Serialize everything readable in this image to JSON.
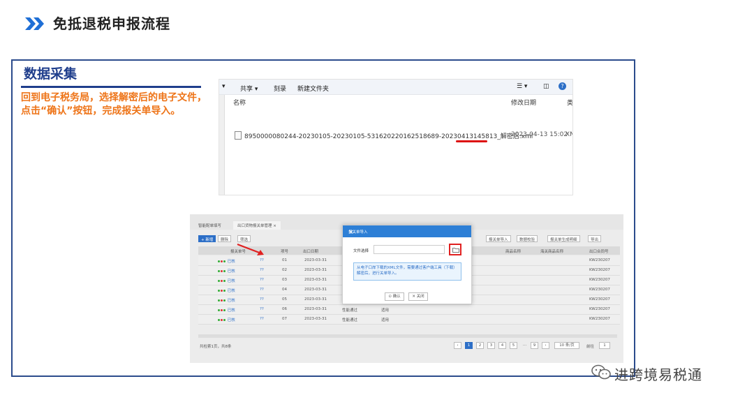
{
  "header": {
    "title": "免抵退税申报流程"
  },
  "section": {
    "title": "数据采集",
    "description": "回到电子税务局，选择解密后的电子文件，点击“确认”按钮，完成报关单导入。"
  },
  "explorer": {
    "toolbar": [
      "共享 ▾",
      "刻录",
      "新建文件夹"
    ],
    "columns": {
      "name": "名称",
      "date": "修改日期",
      "type": "类"
    },
    "file": {
      "name": "8950000080244-20230105-20230105-531620220162518689-20230413145813_解密后.xml",
      "date": "2023-04-13 15:02",
      "type": "XN"
    }
  },
  "grid": {
    "tabs": [
      "智能配单填写",
      "出口货物报关单管理"
    ],
    "toolbar": [
      "+ 新增",
      "删除",
      "筛选"
    ],
    "right_toolbar": [
      "报关单导入",
      "数据校验",
      "报关单生成明细",
      "导出"
    ],
    "columns": [
      "报关单号",
      "项号",
      "出口日期",
      "商品名称",
      "海关商品名称",
      "出口合同号"
    ],
    "rows": [
      {
        "status": "已核",
        "code": "??",
        "item": "01",
        "date": "2023-03-31",
        "extra": "",
        "unit": "",
        "suffix": "KW230207"
      },
      {
        "status": "已核",
        "code": "??",
        "item": "02",
        "date": "2023-03-31",
        "extra": "",
        "unit": "",
        "suffix": "KW230207"
      },
      {
        "status": "已核",
        "code": "??",
        "item": "03",
        "date": "2023-03-31",
        "extra": "",
        "unit": "",
        "suffix": "KW230207"
      },
      {
        "status": "已核",
        "code": "??",
        "item": "04",
        "date": "2023-03-31",
        "extra": "",
        "unit": "",
        "suffix": "KW230207"
      },
      {
        "status": "已核",
        "code": "??",
        "item": "05",
        "date": "2023-03-31",
        "extra": "",
        "unit": "",
        "suffix": "KW230207"
      },
      {
        "status": "已核",
        "code": "??",
        "item": "06",
        "date": "2023-03-31",
        "extra": "性能通过",
        "unit": "适用",
        "suffix": "KW230207"
      },
      {
        "status": "已核",
        "code": "??",
        "item": "07",
        "date": "2023-03-31",
        "extra": "性能通过",
        "unit": "适用",
        "suffix": "KW230207"
      }
    ],
    "footer": "共检索1页，共8条",
    "pages": [
      "1",
      "2",
      "3",
      "4",
      "5",
      "...",
      "9"
    ],
    "page_size": "10 条/页",
    "goto_label": "前往",
    "goto_value": "1"
  },
  "dialog": {
    "title": "报关单导入",
    "file_label": "文件选择",
    "note": "从电子口岸下载的XML文件，需要通过客户端工具（下载）解密后，进行关单导入。",
    "ok": "确认",
    "cancel": "关闭"
  },
  "watermark": "进跨境易税通",
  "colors": {
    "accent_blue": "#1f3e8c",
    "orange": "#ee7418",
    "dialog_blue": "#2d7fd6",
    "highlight_red": "#e02020"
  }
}
